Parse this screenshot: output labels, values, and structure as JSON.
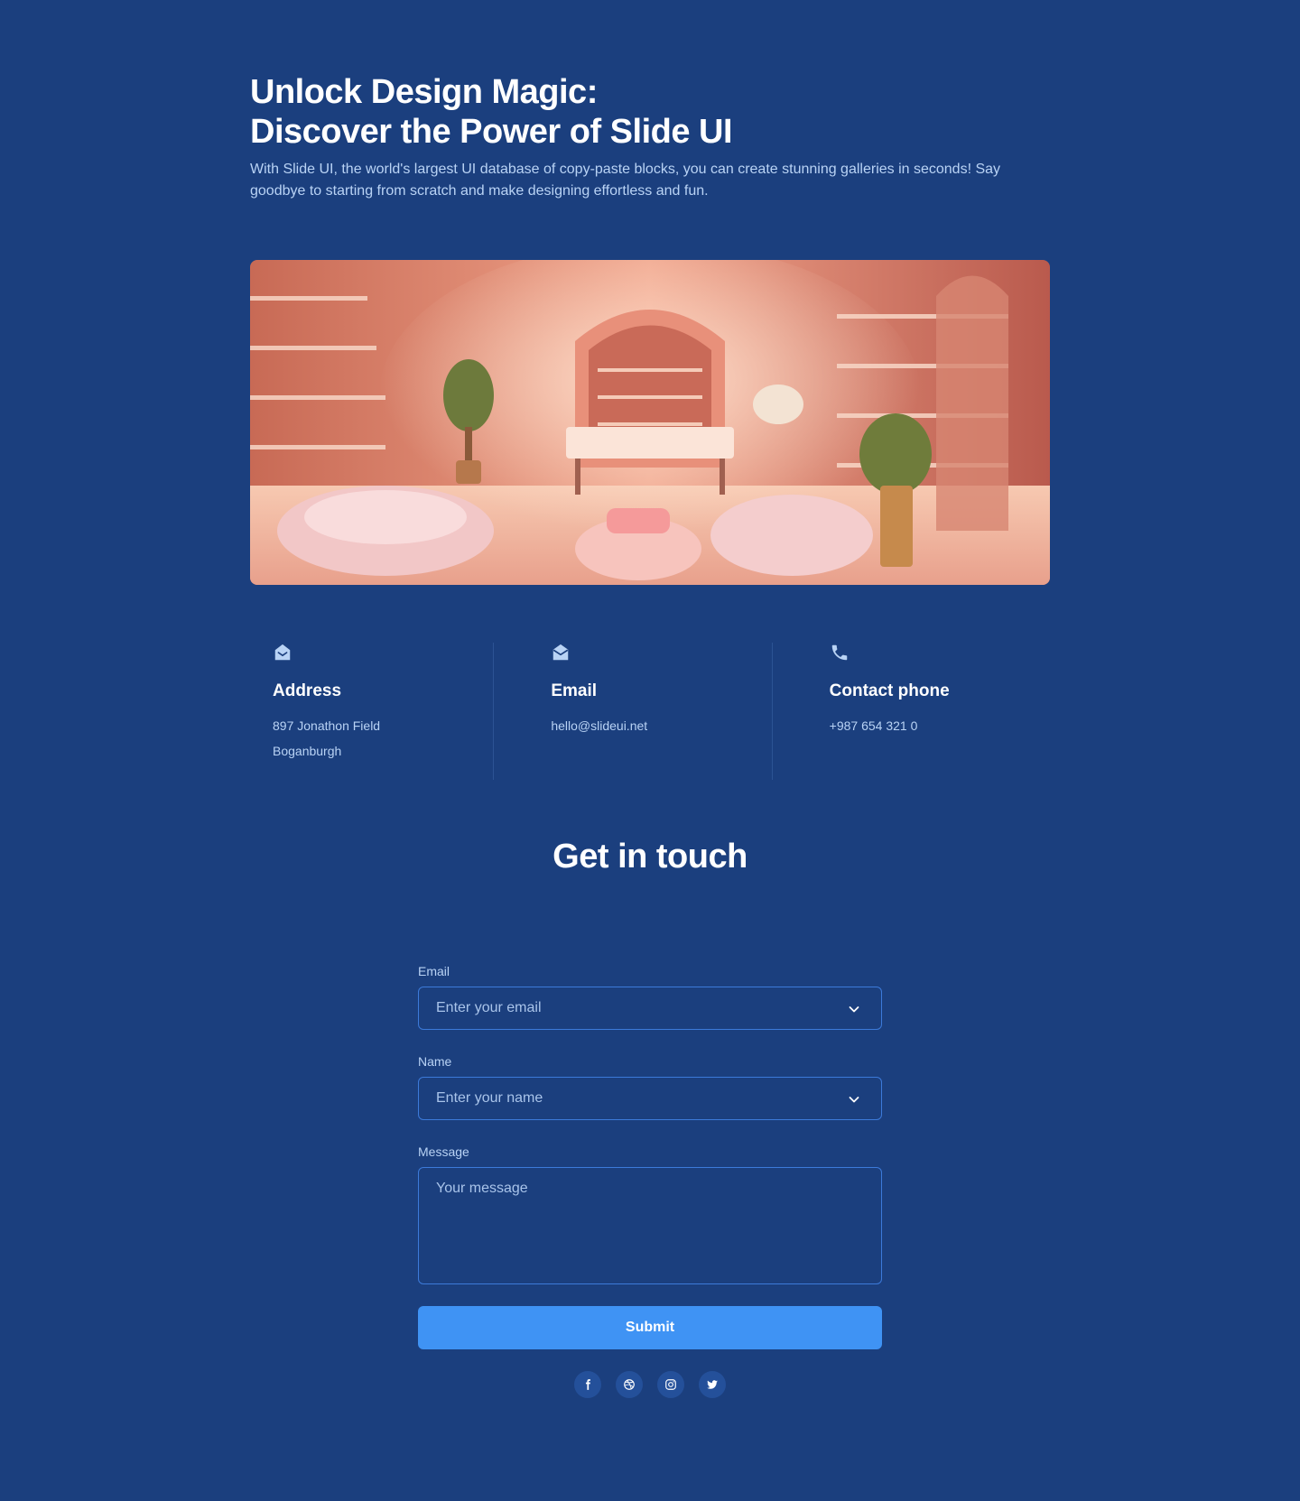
{
  "hero": {
    "title_line1": "Unlock Design Magic:",
    "title_line2": "Discover the Power of Slide UI",
    "description": "With Slide UI, the world's largest UI database of copy-paste blocks, you can create stunning galleries in seconds! Say goodbye to starting from scratch and make designing effortless and fun."
  },
  "info": {
    "address": {
      "icon": "home-envelope-icon",
      "title": "Address",
      "line1": "897 Jonathon Field",
      "line2": "Boganburgh"
    },
    "email": {
      "icon": "envelope-open-icon",
      "title": "Email",
      "line1": "hello@slideui.net"
    },
    "phone": {
      "icon": "phone-icon",
      "title": "Contact phone",
      "line1": "+987 654 321 0"
    }
  },
  "contact": {
    "title": "Get in touch",
    "email_label": "Email",
    "email_placeholder": "Enter your email",
    "name_label": "Name",
    "name_placeholder": "Enter your name",
    "message_label": "Message",
    "message_placeholder": "Your message",
    "submit_label": "Submit"
  },
  "socials": [
    "facebook-icon",
    "dribbble-icon",
    "instagram-icon",
    "twitter-icon"
  ],
  "colors": {
    "background": "#1b3f7e",
    "accent": "#3f93f4",
    "muted_text": "#b9d3f5",
    "border": "#3c7ad9"
  }
}
